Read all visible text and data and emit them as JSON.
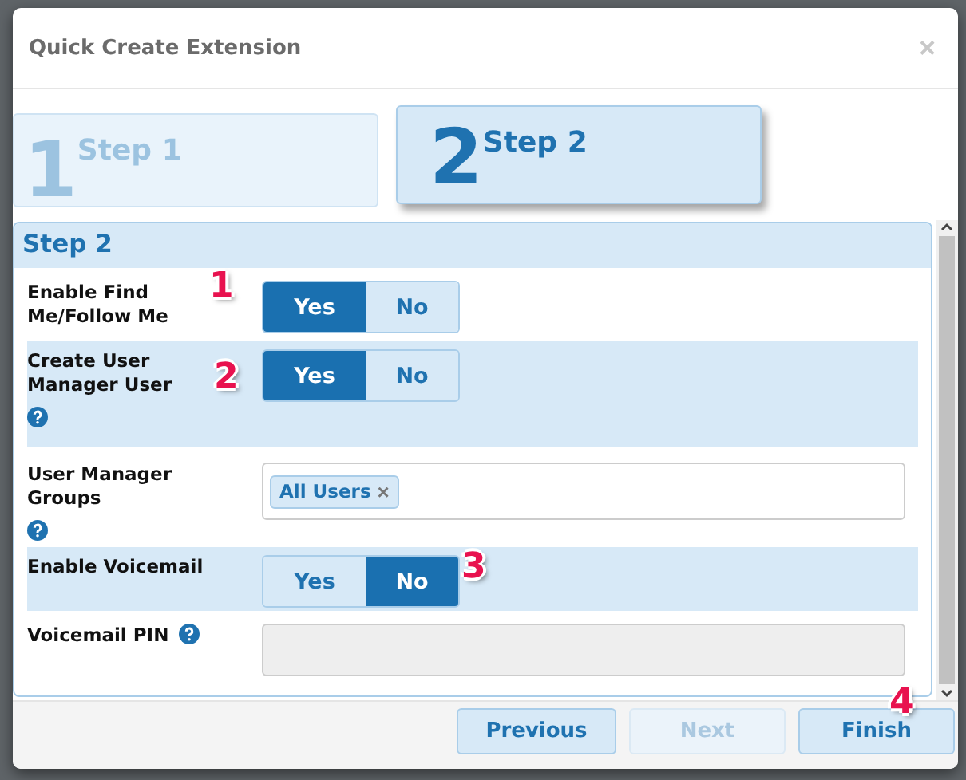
{
  "dialog": {
    "title": "Quick Create Extension",
    "close": "×"
  },
  "steps": [
    {
      "number": "1",
      "label": "Step 1",
      "selected": false
    },
    {
      "number": "2",
      "label": "Step 2",
      "selected": true
    }
  ],
  "section": {
    "title": "Step 2"
  },
  "fields": [
    {
      "kind": "toggle",
      "label": "Enable Find Me/Follow Me",
      "help": false,
      "callout": "1",
      "options": [
        {
          "label": "Yes",
          "selected": true
        },
        {
          "label": "No",
          "selected": false
        }
      ]
    },
    {
      "kind": "toggle",
      "label": "Create User Manager User",
      "help": true,
      "help_inline": false,
      "callout": "2",
      "options": [
        {
          "label": "Yes",
          "selected": true
        },
        {
          "label": "No",
          "selected": false
        }
      ]
    },
    {
      "kind": "tags",
      "label": "User Manager Groups",
      "help": true,
      "help_inline": false,
      "tags": [
        {
          "label": "All Users",
          "remove": "×"
        }
      ]
    },
    {
      "kind": "toggle",
      "label": "Enable Voicemail",
      "help": false,
      "callout": "3",
      "options": [
        {
          "label": "Yes",
          "selected": false
        },
        {
          "label": "No",
          "selected": true
        }
      ]
    },
    {
      "kind": "text",
      "label": "Voicemail PIN",
      "help": true,
      "help_inline": true,
      "disabled": true
    }
  ],
  "buttons": [
    {
      "label": "Previous",
      "disabled": false
    },
    {
      "label": "Next",
      "disabled": true
    },
    {
      "label": "Finish",
      "disabled": false,
      "callout": "4"
    }
  ]
}
